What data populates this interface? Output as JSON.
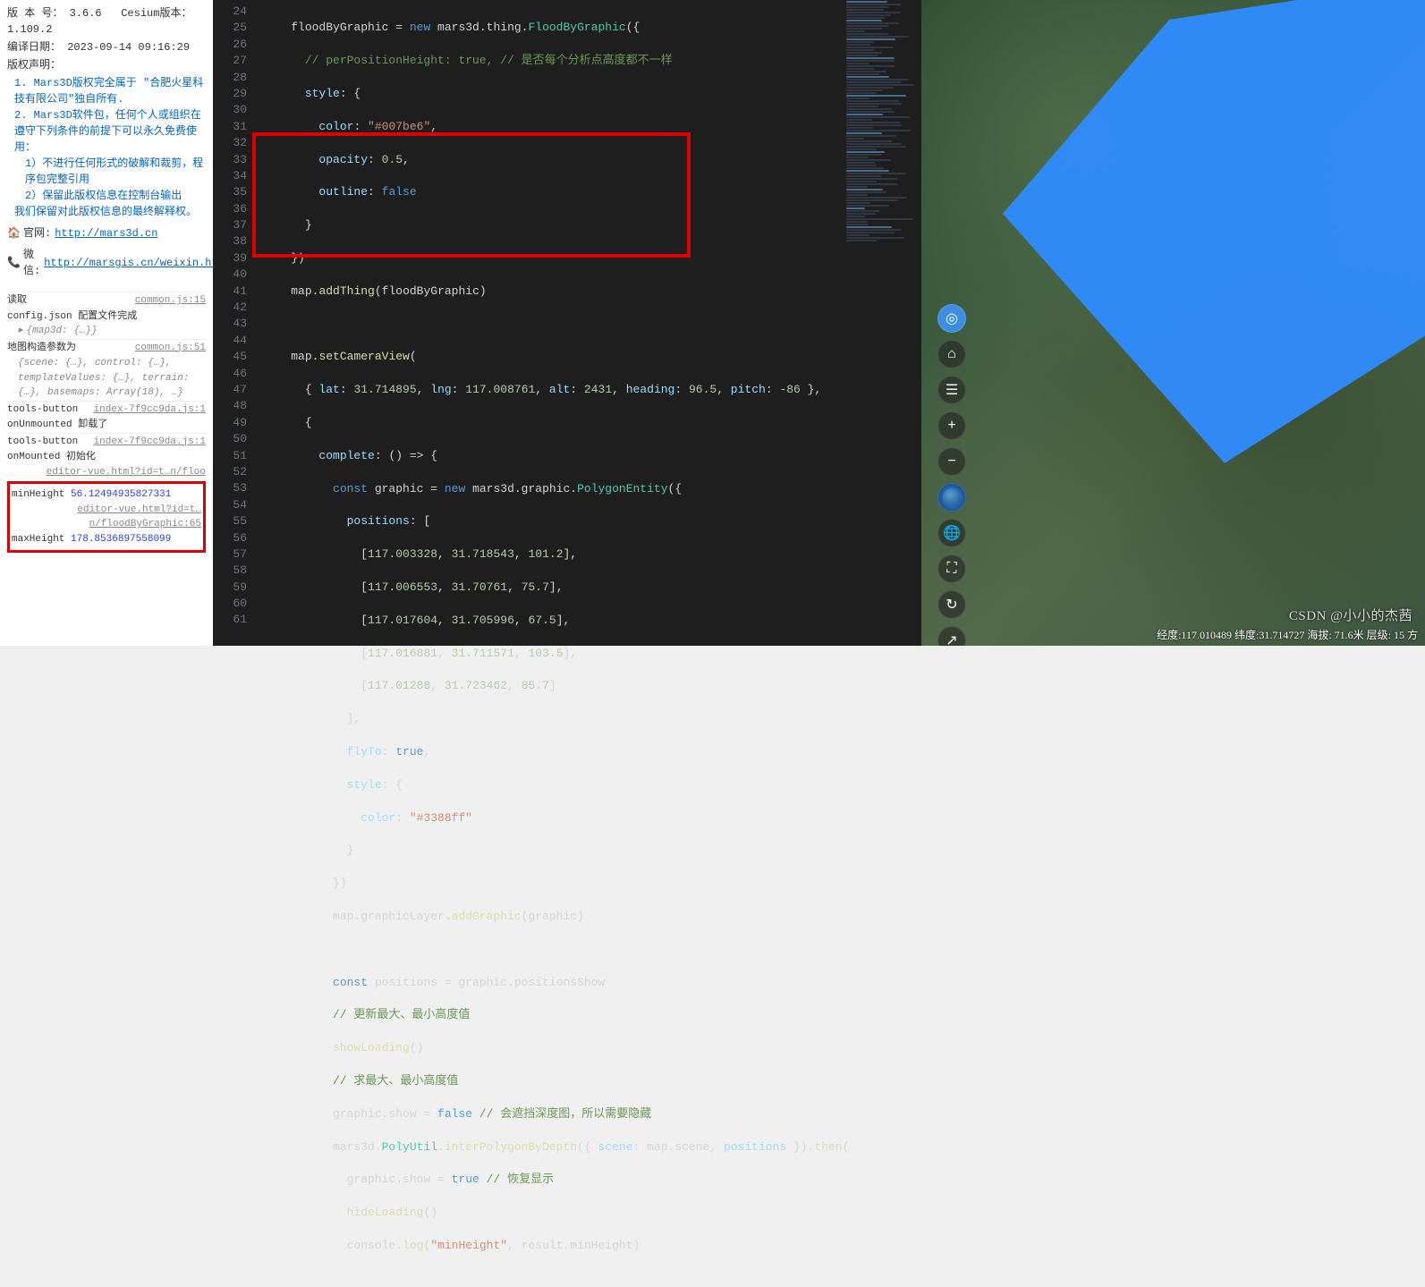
{
  "leftPanel": {
    "versionLabel": "版 本 号：",
    "version": "3.6.6",
    "cesiumLabel": "Cesium版本：",
    "cesiumVersion": "1.109.2",
    "compileLabel": "编译日期：",
    "compileDate": "2023-09-14 09:16:29",
    "copyrightLabel": "版权声明：",
    "cr1": "1. Mars3D版权完全属于 \"合肥火星科技有限公司\"独自所有.",
    "cr2": "2. Mars3D软件包，任何个人或组织在遵守下列条件的前提下可以永久免费使用：",
    "cr2a": "1）不进行任何形式的破解和裁剪，程序包完整引用",
    "cr2b": "2）保留此版权信息在控制台输出",
    "cr3": "我们保留对此版权信息的最终解释权。",
    "siteLabel": "官网:",
    "siteUrl": "http://mars3d.cn",
    "wxLabel": "微信:",
    "wxUrl": "http://marsgis.cn/weixin.html",
    "console": {
      "r1l": "读取",
      "r1r": "common.js:15",
      "r1b": "config.json 配置文件完成",
      "r1sub": "{map3d: {…}}",
      "r2l": "地图构造参数为",
      "r2r": "common.js:51",
      "r2sub": "{scene: {…}, control: {…}, templateValues: {…}, terrain: {…}, basemaps: Array(18), …}",
      "r3l": "tools-button",
      "r3r": "index-7f9cc9da.js:1",
      "r3b": "onUnmounted 卸载了",
      "r4l": "tools-button",
      "r4r": "index-7f9cc9da.js:1",
      "r4b": "onMounted 初始化",
      "r5": "editor-vue.html?id=t…n/floo",
      "r6k": "minHeight",
      "r6v": "56.12494935827331",
      "r7": "editor-vue.html?id=t…n/floodByGraphic:65",
      "r8k": "maxHeight",
      "r8v": "178.8536897558099"
    }
  },
  "editor": {
    "startLine": 24,
    "endLine": 61
  },
  "code": {
    "l24a": "floodByGraphic = ",
    "l24b": "new",
    "l24c": " mars3d.thing.",
    "l24d": "FloodByGraphic",
    "l24e": "({",
    "l25a": "// perPositionHeight: true, ",
    "l25b": "// 是否每个分析点高度都不一样",
    "l26": "style",
    "l26b": ": {",
    "l27": "color",
    "l27b": ": ",
    "l27c": "\"#007be6\"",
    "l27d": ",",
    "l28": "opacity",
    "l28b": ": ",
    "l28c": "0.5",
    "l28d": ",",
    "l29": "outline",
    "l29b": ": ",
    "l29c": "false",
    "l30": "}",
    "l31": "})",
    "l32a": "map.",
    "l32b": "addThing",
    "l32c": "(floodByGraphic)",
    "l34a": "map.",
    "l34b": "setCameraView",
    "l34c": "(",
    "l35a": "{ ",
    "l35lat": "lat",
    "l35b": ": ",
    "l35lv": "31.714895",
    "l35c": ", ",
    "l35lng": "lng",
    "l35d": ": ",
    "l35lnv": "117.008761",
    "l35e": ", ",
    "l35alt": "alt",
    "l35f": ": ",
    "l35av": "2431",
    "l35g": ", ",
    "l35h": "heading",
    "l35i": ": ",
    "l35hv": "96.5",
    "l35j": ", ",
    "l35p": "pitch",
    "l35k": ": ",
    "l35pv": "-86",
    "l35end": " },",
    "l36": "{",
    "l37a": "complete",
    "l37b": ": () => {",
    "l38a": "const",
    "l38b": " graphic = ",
    "l38c": "new",
    "l38d": " mars3d.graphic.",
    "l38e": "PolygonEntity",
    "l38f": "({",
    "l39a": "positions",
    "l39b": ": [",
    "l40": "[",
    "l40a": "117.003328",
    "l40b": ", ",
    "l40c": "31.718543",
    "l40d": ", ",
    "l40e": "101.2",
    "l40f": "],",
    "l41": "[",
    "l41a": "117.006553",
    "l41b": ", ",
    "l41c": "31.70761",
    "l41d": ", ",
    "l41e": "75.7",
    "l41f": "],",
    "l42": "[",
    "l42a": "117.017604",
    "l42b": ", ",
    "l42c": "31.705996",
    "l42d": ", ",
    "l42e": "67.5",
    "l42f": "],",
    "l43": "[",
    "l43a": "117.016881",
    "l43b": ", ",
    "l43c": "31.711571",
    "l43d": ", ",
    "l43e": "103.5",
    "l43f": "],",
    "l44": "[",
    "l44a": "117.01288",
    "l44b": ", ",
    "l44c": "31.723462",
    "l44d": ", ",
    "l44e": "85.7",
    "l44f": "]",
    "l45": "],",
    "l46a": "flyTo",
    "l46b": ": ",
    "l46c": "true",
    "l46d": ",",
    "l47a": "style",
    "l47b": ": {",
    "l48a": "color",
    "l48b": ": ",
    "l48c": "\"#3388ff\"",
    "l49": "}",
    "l50": "})",
    "l51a": "map.graphicLayer.",
    "l51b": "addGraphic",
    "l51c": "(graphic)",
    "l53a": "const",
    "l53b": " positions = graphic.positionsShow",
    "l54": "// 更新最大、最小高度值",
    "l55a": "showLoading",
    "l55b": "()",
    "l56": "// 求最大、最小高度值",
    "l57a": "graphic.show = ",
    "l57b": "false",
    "l57c": " // 会遮挡深度图，所以需要隐藏",
    "l58a": "mars3d.",
    "l58b": "PolyUtil",
    "l58c": ".",
    "l58d": "interPolygonByDepth",
    "l58e": "({ ",
    "l58f": "scene",
    "l58g": ": map.scene, ",
    "l58h": "positions",
    "l58i": " }).",
    "l58j": "then",
    "l58k": "(",
    "l59a": "graphic.show = ",
    "l59b": "true",
    "l59c": " // 恢复显示",
    "l60a": "hideLoading",
    "l60b": "()",
    "l61a": "console.",
    "l61b": "log",
    "l61c": "(",
    "l61d": "\"minHeight\"",
    "l61e": ", result.minHeight)"
  },
  "map": {
    "statusBar": "经度:117.010489  纬度:31.714727  海拔: 71.6米  层级: 15  方",
    "watermark": "CSDN @小小的杰茜",
    "toolbar": [
      "target",
      "home",
      "layers",
      "plus",
      "minus",
      "earth",
      "globe",
      "expand",
      "rotate",
      "cursor"
    ]
  }
}
